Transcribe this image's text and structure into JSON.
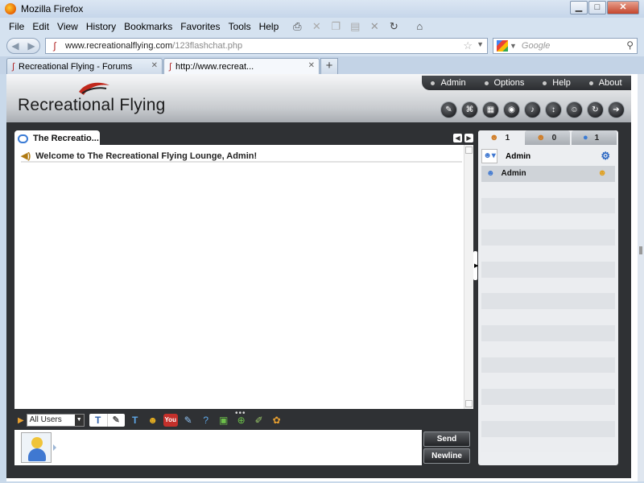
{
  "window": {
    "title": "Mozilla Firefox",
    "minimize": "▁",
    "maximize": "□",
    "close": "✕"
  },
  "menubar": {
    "items": [
      "File",
      "Edit",
      "View",
      "History",
      "Bookmarks",
      "Favorites",
      "Tools",
      "Help"
    ],
    "toolbar_icons": [
      "print-icon",
      "close-icon",
      "copy-icon",
      "paste-icon",
      "stop-icon",
      "reload-icon",
      "home-icon"
    ]
  },
  "navbar": {
    "url_host": "www.recreationalflying.com",
    "url_path": "/123flashchat.php",
    "search_placeholder": "Google"
  },
  "tabs": [
    {
      "label": "Recreational Flying - Forums",
      "active": false
    },
    {
      "label": "http://www.recreat...",
      "active": true
    }
  ],
  "app": {
    "logo_text": "Recreational Flying",
    "topnav": [
      "Admin",
      "Options",
      "Help",
      "About"
    ],
    "tool_icons": [
      "tools-icon",
      "game-icon",
      "whiteboard-icon",
      "webcam-icon",
      "sound-icon",
      "scroll-icon",
      "emote-icon",
      "refresh-icon",
      "exit-icon"
    ],
    "room_tab": "The Recreatio...",
    "welcome_message": "Welcome to The Recreational Flying Lounge, Admin!",
    "recipient_select": "All Users",
    "format_icons": [
      "text-style-icon",
      "pen-icon"
    ],
    "input_icons": [
      "font-icon",
      "smiley-icon",
      "youtube-icon",
      "edit-icon",
      "help-icon",
      "image-icon",
      "add-icon",
      "paint-icon",
      "palette-icon"
    ],
    "send_label": "Send",
    "newline_label": "Newline"
  },
  "userpanel": {
    "tabs": [
      {
        "icon": "users-icon",
        "count": "1"
      },
      {
        "icon": "rooms-icon",
        "count": "0"
      },
      {
        "icon": "chat-icon",
        "count": "1"
      }
    ],
    "me": {
      "name": "Admin"
    },
    "users": [
      {
        "name": "Admin"
      }
    ]
  },
  "colors": {
    "app_dark": "#2f3134",
    "accent_blue": "#3f78d1",
    "firefox_chrome": "#d5e2f0"
  }
}
